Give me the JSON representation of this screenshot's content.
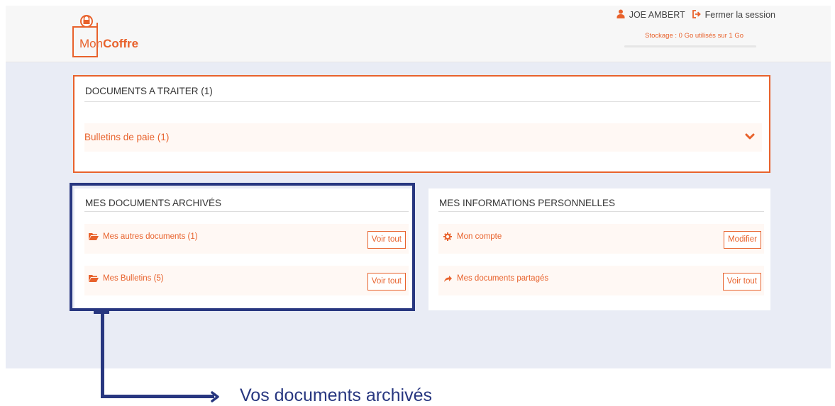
{
  "brand": {
    "name_prefix": "Mon",
    "name_suffix": "Coffre",
    "color": "#e8622c"
  },
  "header": {
    "user_name": "JOE AMBERT",
    "logout_label": "Fermer la session",
    "storage_text": "Stockage : 0 Go utilisés sur 1 Go",
    "storage_used_fraction": 0,
    "icons": {
      "user": "user-icon",
      "logout": "logout-icon"
    }
  },
  "to_process": {
    "title": "DOCUMENTS A TRAITER (1)",
    "items": [
      {
        "label": "Bulletins de paie (1)",
        "icon": "chevron-down-icon"
      }
    ]
  },
  "archived": {
    "title": "MES DOCUMENTS ARCHIVÉS",
    "items": [
      {
        "label": "Mes autres documents (1)",
        "button": "Voir tout",
        "icon": "folder-open-icon"
      },
      {
        "label": "Mes Bulletins (5)",
        "button": "Voir tout",
        "icon": "folder-open-icon"
      }
    ]
  },
  "personal": {
    "title": "MES INFORMATIONS PERSONNELLES",
    "items": [
      {
        "label": "Mon compte",
        "button": "Modifier",
        "icon": "gear-icon"
      },
      {
        "label": "Mes documents partagés",
        "button": "Voir tout",
        "icon": "share-arrow-icon"
      }
    ]
  },
  "annotation": {
    "callout": "Vos documents archivés",
    "color": "#283780"
  }
}
